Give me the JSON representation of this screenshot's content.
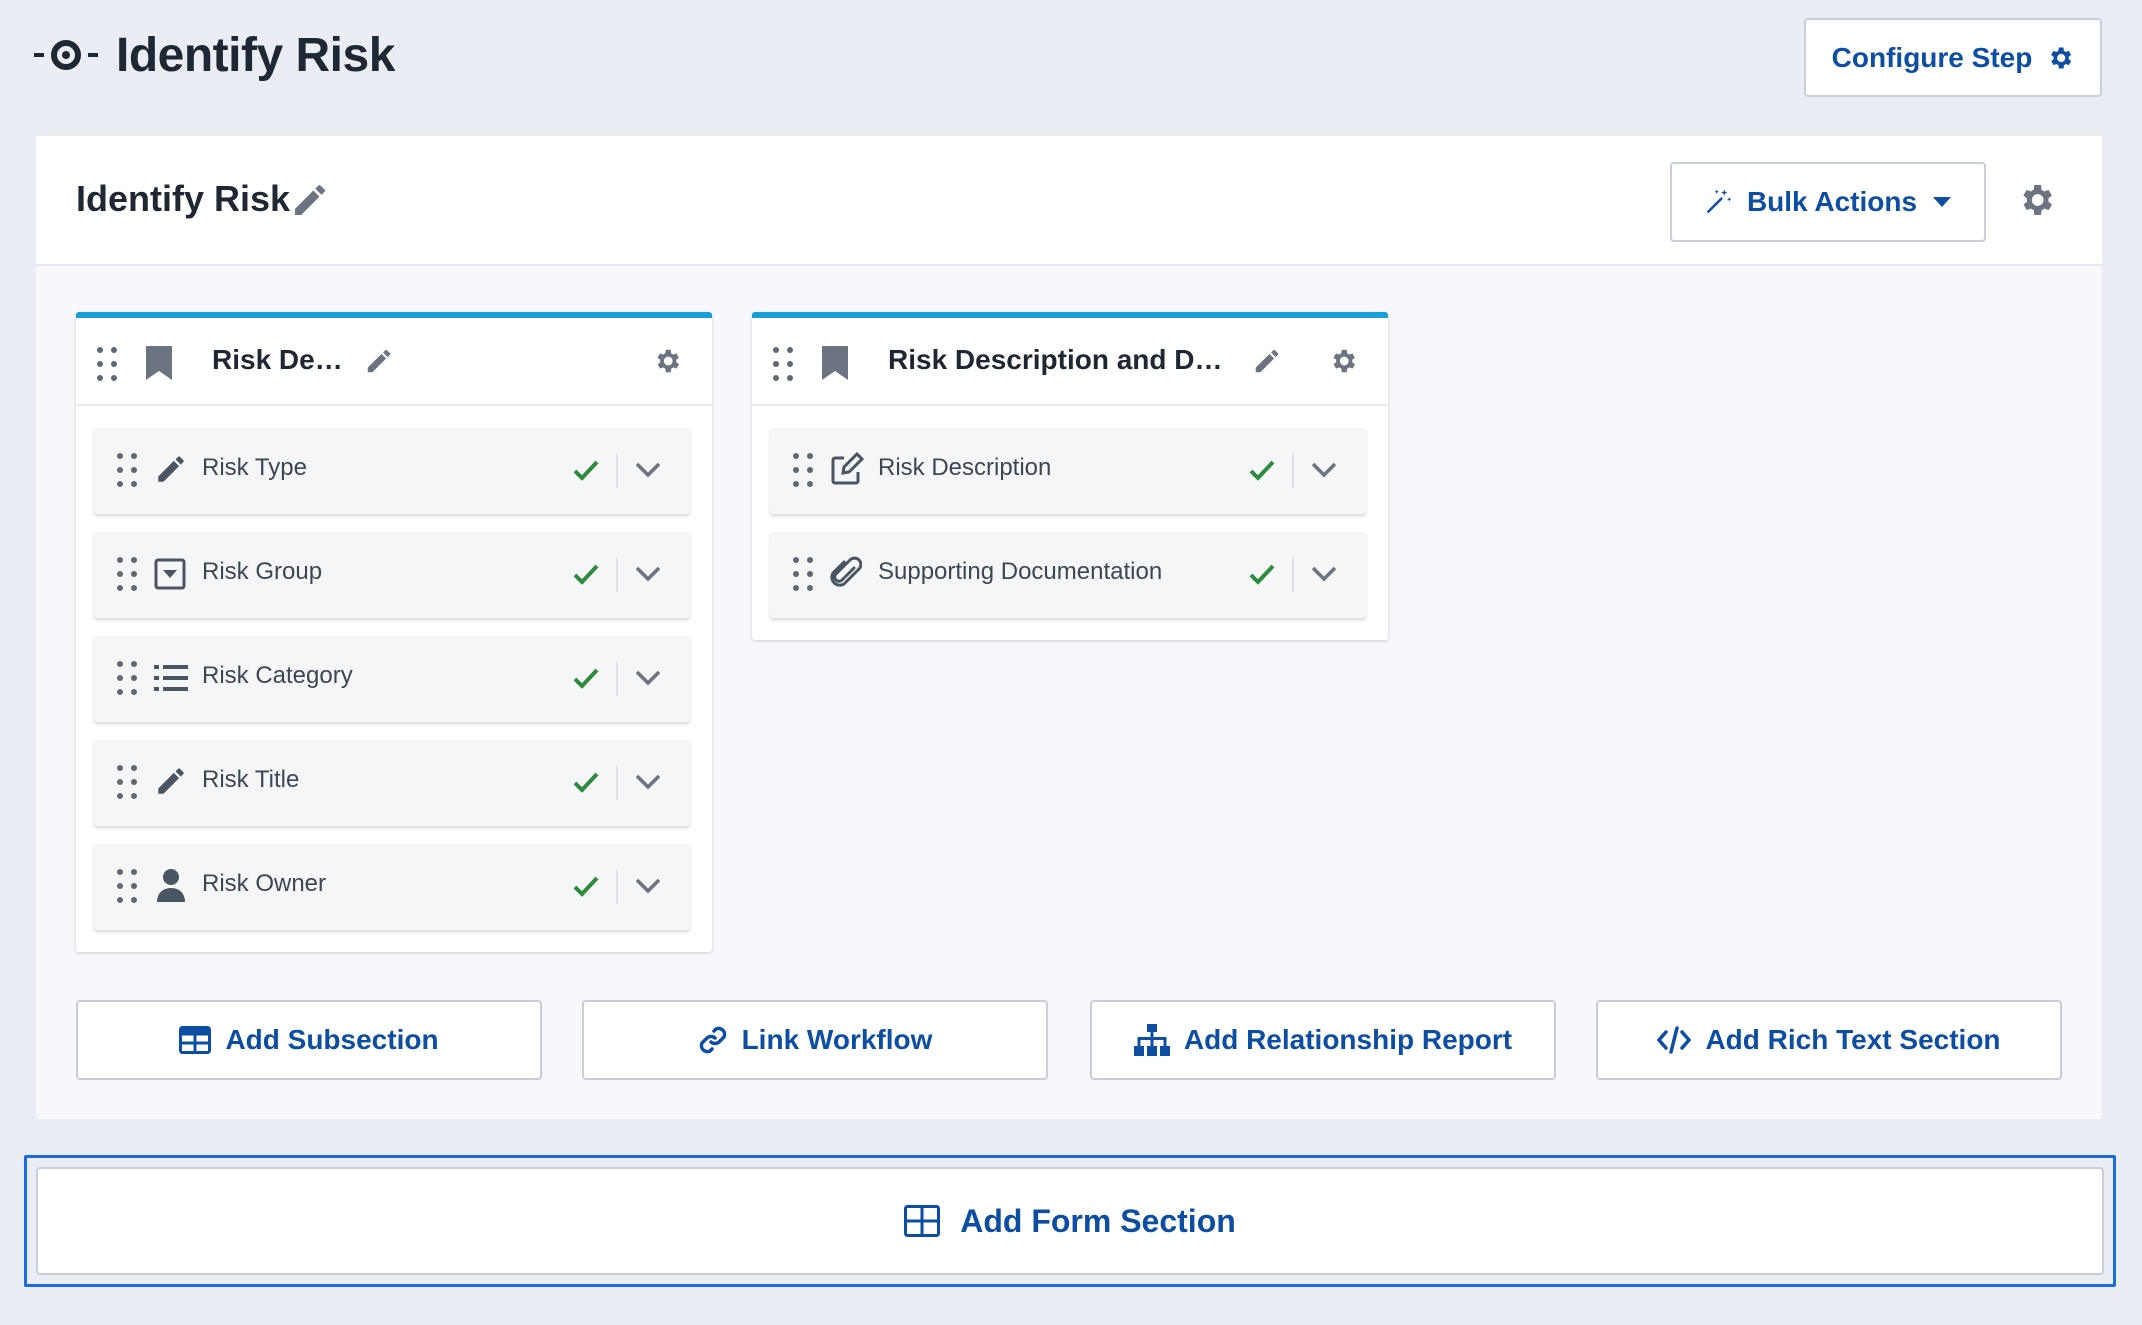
{
  "header": {
    "title": "Identify Risk",
    "configure_label": "Configure Step"
  },
  "panel": {
    "title": "Identify Risk",
    "bulk_label": "Bulk Actions"
  },
  "sections": [
    {
      "title": "Risk Details",
      "fields": [
        {
          "label": "Risk Type",
          "icon": "pencil-icon"
        },
        {
          "label": "Risk Group",
          "icon": "dropdown-icon"
        },
        {
          "label": "Risk Category",
          "icon": "list-icon"
        },
        {
          "label": "Risk Title",
          "icon": "pencil-icon"
        },
        {
          "label": "Risk Owner",
          "icon": "user-icon"
        }
      ]
    },
    {
      "title": "Risk Description and Docu…",
      "fields": [
        {
          "label": "Risk Description",
          "icon": "edit-box-icon"
        },
        {
          "label": "Supporting Documentation",
          "icon": "paperclip-icon"
        }
      ]
    }
  ],
  "actions": {
    "add_subsection": "Add Subsection",
    "link_workflow": "Link Workflow",
    "add_relationship_report": "Add Relationship Report",
    "add_rich_text": "Add Rich Text Section",
    "add_form_section": "Add Form Section"
  },
  "colors": {
    "accent": "#0b4ea2",
    "card_top": "#1aa0d8",
    "check": "#2e8b3e",
    "focus": "#1a6ae0"
  }
}
